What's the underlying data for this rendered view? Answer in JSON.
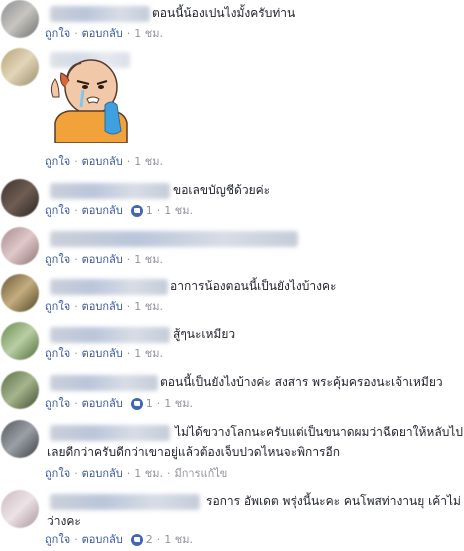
{
  "comments": [
    {
      "text": "ตอนนี้น้องเปนไงมั้งครับท่าน",
      "actions": {
        "like": "ถูกใจ",
        "reply": "ตอบกลับ",
        "time": "1 ชม."
      }
    },
    {
      "text": "",
      "sticker": "crying-man-sticker",
      "actions": {
        "like": "ถูกใจ",
        "reply": "ตอบกลับ",
        "time": "1 ชม."
      }
    },
    {
      "text": "ขอเลขบัญชีด้วยค่ะ",
      "actions": {
        "like": "ถูกใจ",
        "reply": "ตอบกลับ",
        "likes": "1",
        "time": "1 ชม."
      }
    },
    {
      "text": "",
      "actions": {
        "like": "ถูกใจ",
        "reply": "ตอบกลับ",
        "time": "1 ชม."
      }
    },
    {
      "text": "อาการน้องตอนนี้เป็นยังไงบ้างคะ",
      "actions": {
        "like": "ถูกใจ",
        "reply": "ตอบกลับ",
        "time": "1 ชม."
      }
    },
    {
      "text": "สู้ๆนะเหมียว",
      "actions": {
        "like": "ถูกใจ",
        "reply": "ตอบกลับ",
        "time": "1 ชม."
      }
    },
    {
      "text": "ตอนนี้เป็นยังไงบ้างค่ะ สงสาร พระคุ้มครองนะเจ้าเหมียว",
      "actions": {
        "like": "ถูกใจ",
        "reply": "ตอบกลับ",
        "likes": "1",
        "time": "1 ชม."
      }
    },
    {
      "text_line1": "ไม่ได้ขวางโลกนะครับแต่เป็นขนาดผมว่าฉีดยาให้หลับไป",
      "text_line2": "เลยดีกว่าครับดีกว่าเขาอยู่แล้วต้องเจ็บปวดไหนจะพิการอีก",
      "actions": {
        "like": "ถูกใจ",
        "reply": "ตอบกลับ",
        "time": "1 ชม.",
        "edited": "มีการแก้ไข"
      }
    },
    {
      "text_line1": "รอการ อัพเดต พรุ่งนี้นะคะ คนโพสท่างานยุ เค้าไม่",
      "text_line2": "ว่างคะ",
      "actions": {
        "like": "ถูกใจ",
        "reply": "ตอบกลับ",
        "likes": "2",
        "time": "1 ชม."
      }
    }
  ],
  "colors": {
    "link": "#385898",
    "meta_gray": "#90949c",
    "like_blue": "#4267b2",
    "text": "#1d2129"
  }
}
